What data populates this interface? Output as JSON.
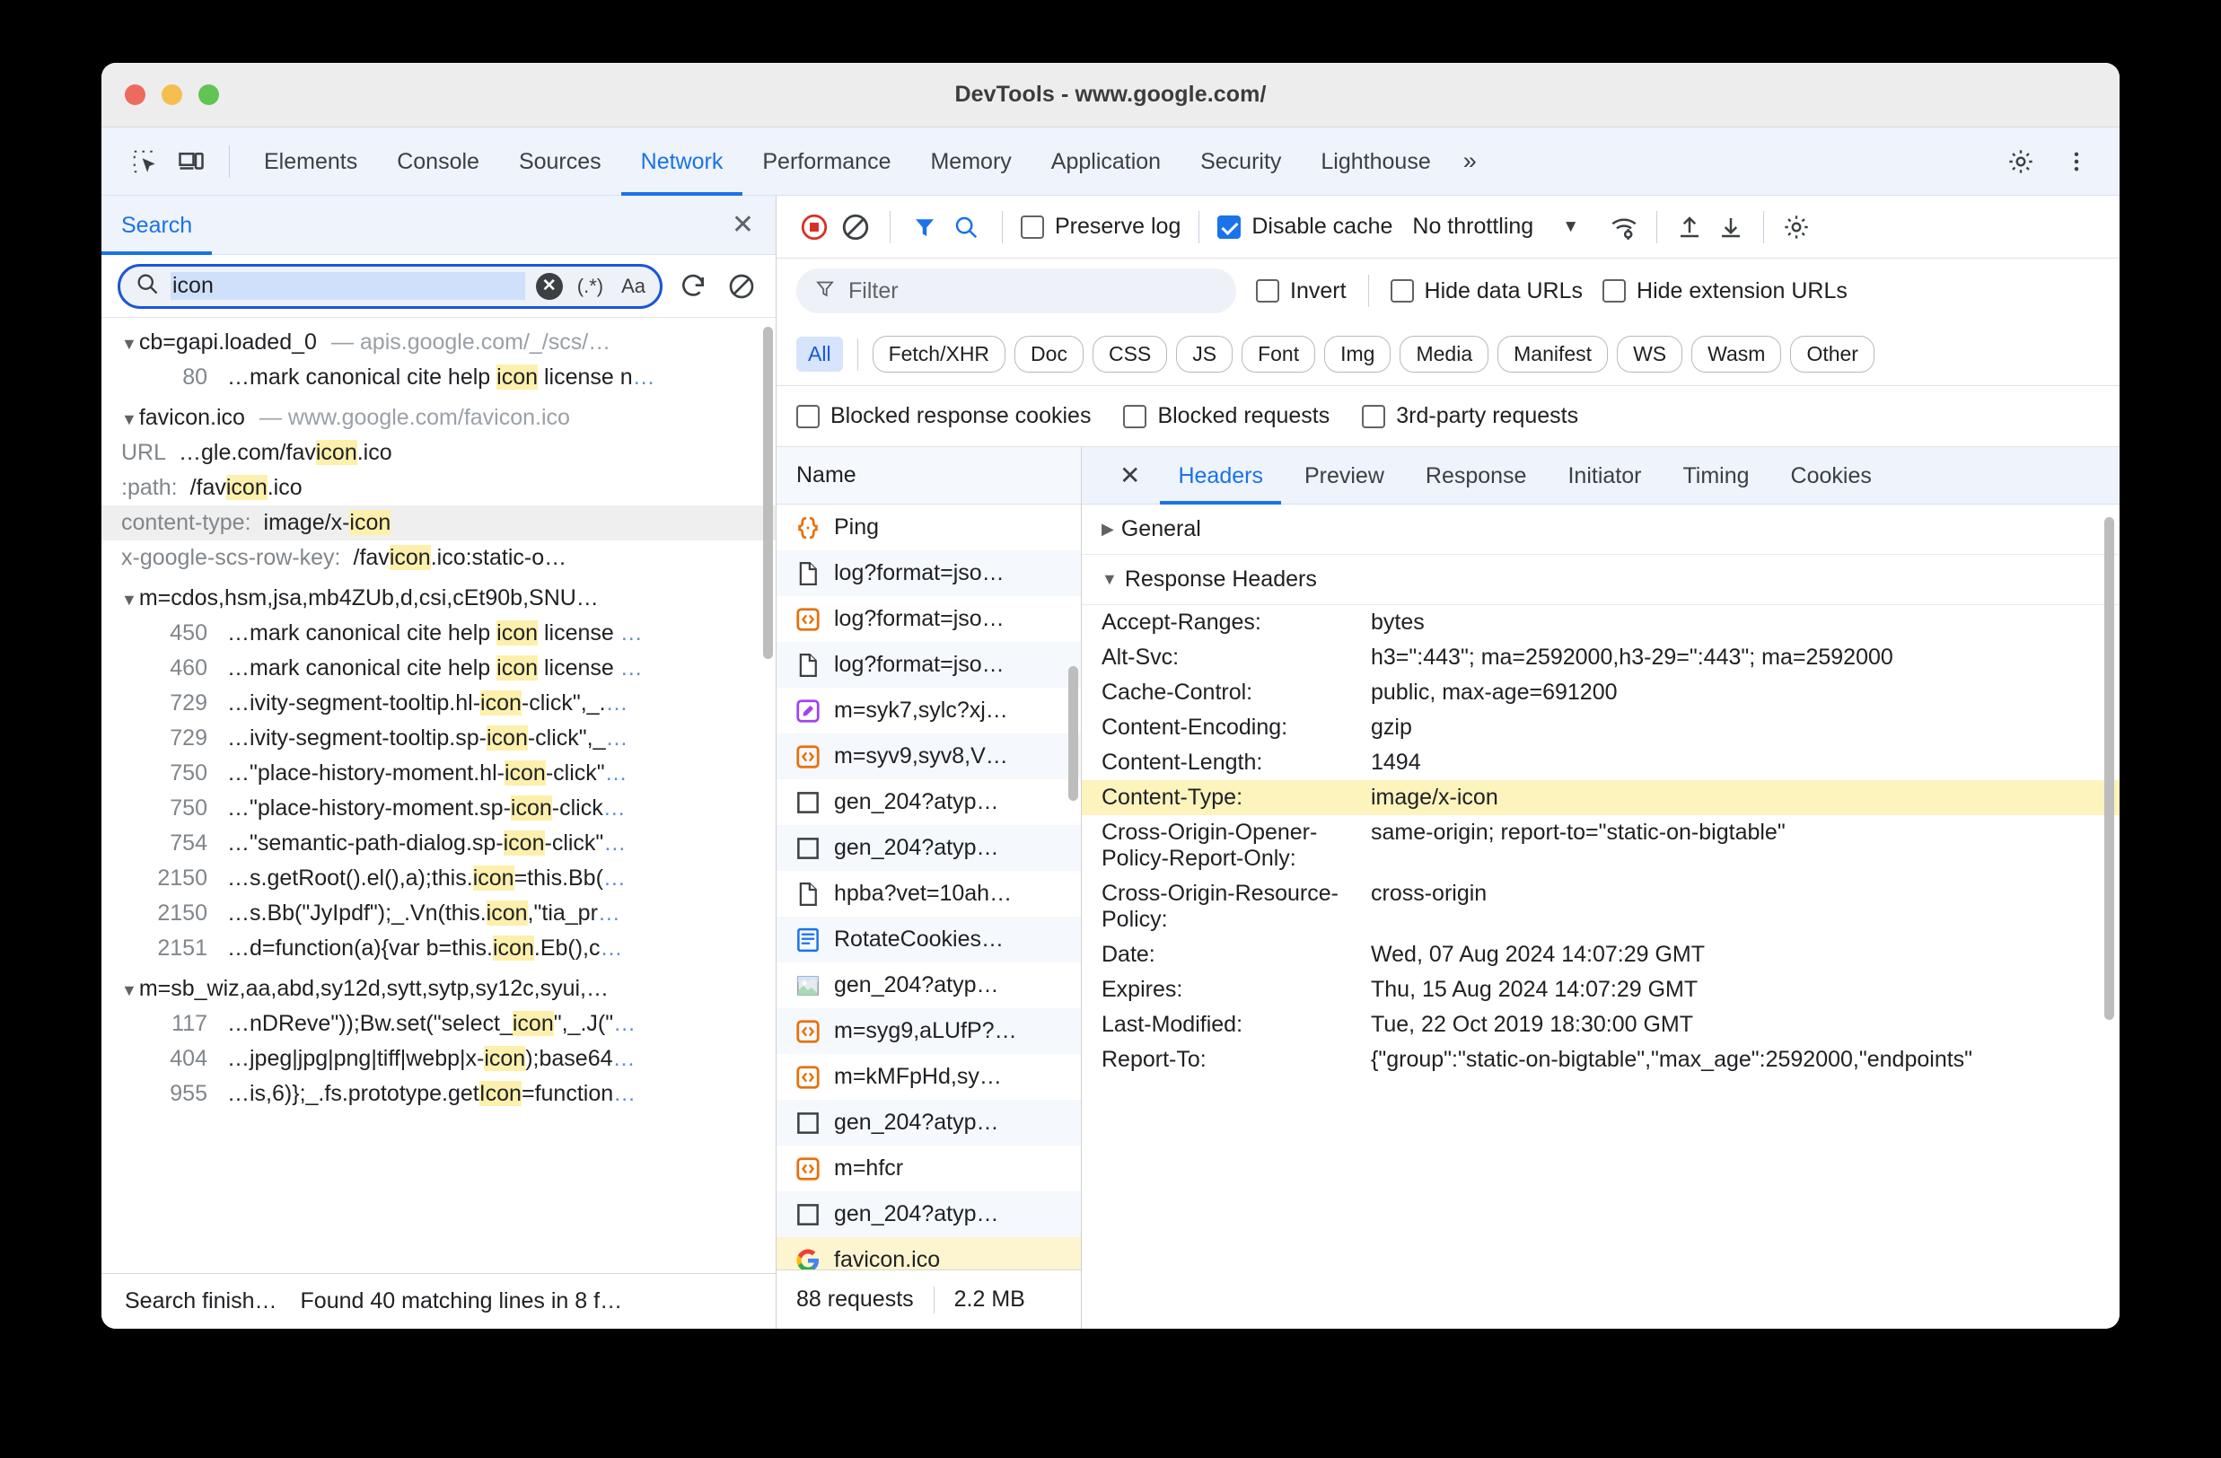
{
  "window": {
    "title": "DevTools - www.google.com/"
  },
  "main_tabs": [
    {
      "label": "Elements",
      "active": false
    },
    {
      "label": "Console",
      "active": false
    },
    {
      "label": "Sources",
      "active": false
    },
    {
      "label": "Network",
      "active": true
    },
    {
      "label": "Performance",
      "active": false
    },
    {
      "label": "Memory",
      "active": false
    },
    {
      "label": "Application",
      "active": false
    },
    {
      "label": "Security",
      "active": false
    },
    {
      "label": "Lighthouse",
      "active": false
    }
  ],
  "main_tabs_overflow": "»",
  "search_panel": {
    "tab_label": "Search",
    "query": "icon",
    "regex_label": "(.*)",
    "matchcase_label": "Aa",
    "status_text": "Search finish…",
    "status_result": "Found 40 matching lines in 8 f…",
    "groups": [
      {
        "title": "cb=gapi.loaded_0",
        "sub": "apis.google.com/_/scs/…",
        "lines": [
          {
            "no": "80",
            "pre": "…mark canonical cite help ",
            "hl": "icon",
            "post": " license n",
            "ell": "…"
          }
        ]
      },
      {
        "title": "favicon.ico",
        "sub": "www.google.com/favicon.ico",
        "kv": [
          {
            "key": "URL",
            "pre": "…gle.com/fav",
            "hl": "icon",
            "post": ".ico"
          },
          {
            "key": ":path:",
            "pre": "/fav",
            "hl": "icon",
            "post": ".ico"
          },
          {
            "key": "content-type:",
            "pre": "image/x-",
            "hl": "icon",
            "post": "",
            "selected": true
          },
          {
            "key": "x-google-scs-row-key:",
            "pre": "/fav",
            "hl": "icon",
            "post": ".ico:static-o…"
          }
        ]
      },
      {
        "title": "m=cdos,hsm,jsa,mb4ZUb,d,csi,cEt90b,SNU…",
        "sub": "",
        "lines": [
          {
            "no": "450",
            "pre": "…mark canonical cite help ",
            "hl": "icon",
            "post": " license ",
            "ell": "…"
          },
          {
            "no": "460",
            "pre": "…mark canonical cite help ",
            "hl": "icon",
            "post": " license ",
            "ell": "…"
          },
          {
            "no": "729",
            "pre": "…ivity-segment-tooltip.hl-",
            "hl": "icon",
            "post": "-click\",_.",
            "ell": "…"
          },
          {
            "no": "729",
            "pre": "…ivity-segment-tooltip.sp-",
            "hl": "icon",
            "post": "-click\",_",
            "ell": "…"
          },
          {
            "no": "750",
            "pre": "…\"place-history-moment.hl-",
            "hl": "icon",
            "post": "-click\"",
            "ell": "…"
          },
          {
            "no": "750",
            "pre": "…\"place-history-moment.sp-",
            "hl": "icon",
            "post": "-click",
            "ell": "…"
          },
          {
            "no": "754",
            "pre": "…\"semantic-path-dialog.sp-",
            "hl": "icon",
            "post": "-click\"",
            "ell": "…"
          },
          {
            "no": "2150",
            "pre": "…s.getRoot().el(),a);this.",
            "hl": "icon",
            "post": "=this.Bb(",
            "ell": "…"
          },
          {
            "no": "2150",
            "pre": "…s.Bb(\"JyIpdf\");_.Vn(this.",
            "hl": "icon",
            "post": ",\"tia_pr",
            "ell": "…"
          },
          {
            "no": "2151",
            "pre": "…d=function(a){var b=this.",
            "hl": "icon",
            "post": ".Eb(),c",
            "ell": "…"
          }
        ]
      },
      {
        "title": "m=sb_wiz,aa,abd,sy12d,sytt,sytp,sy12c,syui,…",
        "sub": "",
        "lines": [
          {
            "no": "117",
            "pre": "…nDReve\"));Bw.set(\"select_",
            "hl": "icon",
            "post": "\",_.J(\"",
            "ell": "…"
          },
          {
            "no": "404",
            "pre": "…jpeg|jpg|png|tiff|webp|x-",
            "hl": "icon",
            "post": ");base64",
            "ell": "…"
          },
          {
            "no": "955",
            "pre": "…is,6)};_.fs.prototype.get",
            "hl": "Icon",
            "post": "=function",
            "ell": "…"
          }
        ]
      }
    ]
  },
  "network": {
    "toolbar": {
      "preserve_log_label": "Preserve log",
      "preserve_log_checked": false,
      "disable_cache_label": "Disable cache",
      "disable_cache_checked": true,
      "throttling_label": "No throttling"
    },
    "filterbar": {
      "filter_placeholder": "Filter",
      "invert_label": "Invert",
      "invert_checked": false,
      "hide_data_urls_label": "Hide data URLs",
      "hide_data_urls_checked": false,
      "hide_extension_urls_label": "Hide extension URLs",
      "hide_extension_urls_checked": false
    },
    "type_chips": [
      {
        "label": "All",
        "active": true
      },
      {
        "label": "Fetch/XHR",
        "active": false
      },
      {
        "label": "Doc",
        "active": false
      },
      {
        "label": "CSS",
        "active": false
      },
      {
        "label": "JS",
        "active": false
      },
      {
        "label": "Font",
        "active": false
      },
      {
        "label": "Img",
        "active": false
      },
      {
        "label": "Media",
        "active": false
      },
      {
        "label": "Manifest",
        "active": false
      },
      {
        "label": "WS",
        "active": false
      },
      {
        "label": "Wasm",
        "active": false
      },
      {
        "label": "Other",
        "active": false
      }
    ],
    "cookie_filters": [
      {
        "label": "Blocked response cookies",
        "checked": false
      },
      {
        "label": "Blocked requests",
        "checked": false
      },
      {
        "label": "3rd-party requests",
        "checked": false
      }
    ],
    "list_header": "Name",
    "requests": [
      {
        "name": "Ping",
        "icon": "json-icon",
        "selected": false
      },
      {
        "name": "log?format=jso…",
        "icon": "doc-icon",
        "selected": false
      },
      {
        "name": "log?format=jso…",
        "icon": "script-icon",
        "selected": false
      },
      {
        "name": "log?format=jso…",
        "icon": "doc-icon",
        "selected": false
      },
      {
        "name": "m=syk7,sylc?xj…",
        "icon": "stylesheet-icon",
        "selected": false
      },
      {
        "name": "m=syv9,syv8,V…",
        "icon": "script-icon",
        "selected": false
      },
      {
        "name": "gen_204?atyp…",
        "icon": "generic-icon",
        "selected": false
      },
      {
        "name": "gen_204?atyp…",
        "icon": "generic-icon",
        "selected": false
      },
      {
        "name": "hpba?vet=10ah…",
        "icon": "doc-icon",
        "selected": false
      },
      {
        "name": "RotateCookies…",
        "icon": "document-blue-icon",
        "selected": false
      },
      {
        "name": "gen_204?atyp…",
        "icon": "image-icon",
        "selected": false
      },
      {
        "name": "m=syg9,aLUfP?…",
        "icon": "script-icon",
        "selected": false
      },
      {
        "name": "m=kMFpHd,sy…",
        "icon": "script-icon",
        "selected": false
      },
      {
        "name": "gen_204?atyp…",
        "icon": "generic-icon",
        "selected": false
      },
      {
        "name": "m=hfcr",
        "icon": "script-icon",
        "selected": false
      },
      {
        "name": "gen_204?atyp…",
        "icon": "generic-icon",
        "selected": false
      },
      {
        "name": "favicon.ico",
        "icon": "google-favicon-icon",
        "selected": true
      }
    ],
    "status": {
      "requests": "88 requests",
      "size": "2.2 MB"
    },
    "detail_tabs": [
      {
        "label": "Headers",
        "active": true
      },
      {
        "label": "Preview",
        "active": false
      },
      {
        "label": "Response",
        "active": false
      },
      {
        "label": "Initiator",
        "active": false
      },
      {
        "label": "Timing",
        "active": false
      },
      {
        "label": "Cookies",
        "active": false
      }
    ],
    "sections": {
      "general_label": "General",
      "general_expanded": false,
      "response_headers_label": "Response Headers",
      "response_headers_expanded": true
    },
    "response_headers": [
      {
        "name": "Accept-Ranges:",
        "value": "bytes",
        "highlight": false
      },
      {
        "name": "Alt-Svc:",
        "value": "h3=\":443\"; ma=2592000,h3-29=\":443\"; ma=2592000",
        "highlight": false
      },
      {
        "name": "Cache-Control:",
        "value": "public, max-age=691200",
        "highlight": false
      },
      {
        "name": "Content-Encoding:",
        "value": "gzip",
        "highlight": false
      },
      {
        "name": "Content-Length:",
        "value": "1494",
        "highlight": false
      },
      {
        "name": "Content-Type:",
        "value": "image/x-icon",
        "highlight": true
      },
      {
        "name": "Cross-Origin-Opener-Policy-Report-Only:",
        "value": "same-origin; report-to=\"static-on-bigtable\"",
        "highlight": false
      },
      {
        "name": "Cross-Origin-Resource-Policy:",
        "value": "cross-origin",
        "highlight": false
      },
      {
        "name": "Date:",
        "value": "Wed, 07 Aug 2024 14:07:29 GMT",
        "highlight": false
      },
      {
        "name": "Expires:",
        "value": "Thu, 15 Aug 2024 14:07:29 GMT",
        "highlight": false
      },
      {
        "name": "Last-Modified:",
        "value": "Tue, 22 Oct 2019 18:30:00 GMT",
        "highlight": false
      },
      {
        "name": "Report-To:",
        "value": "{\"group\":\"static-on-bigtable\",\"max_age\":2592000,\"endpoints\"",
        "highlight": false
      }
    ]
  },
  "colors": {
    "accent": "#1a73e8",
    "highlight": "#fdf0ac",
    "selected_row": "#fdf5cf"
  }
}
